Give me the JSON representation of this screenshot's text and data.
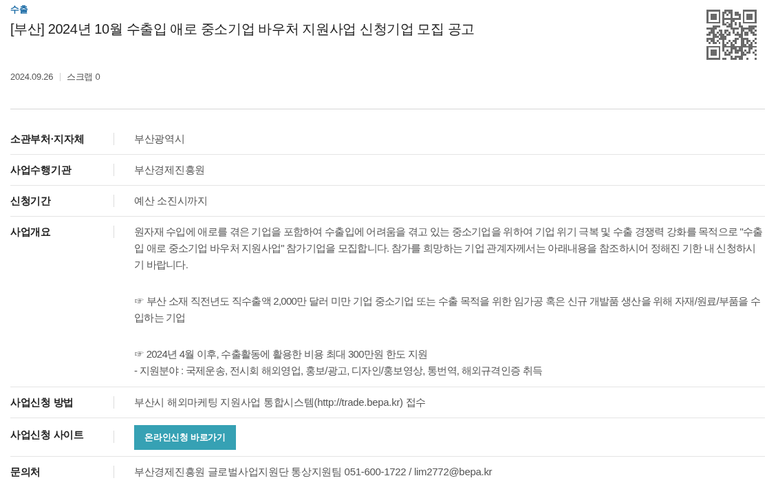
{
  "category": "수출",
  "title": "[부산] 2024년 10월 수출입 애로 중소기업 바우처 지원사업 신청기업 모집 공고",
  "meta": {
    "date": "2024.09.26",
    "scrap": "스크랩 0"
  },
  "details": [
    {
      "kind": "text",
      "label": "소관부처·지자체",
      "value": "부산광역시"
    },
    {
      "kind": "text",
      "label": "사업수행기관",
      "value": "부산경제진흥원"
    },
    {
      "kind": "text",
      "label": "신청기간",
      "value": "예산 소진시까지"
    },
    {
      "kind": "paragraphs",
      "label": "사업개요",
      "paragraphs": [
        [
          "원자재 수입에 애로를 겪은 기업을 포함하여 수출입에 어려움을 겪고 있는 중소기업을 위하여 기업 위기 극복 및 수출 경쟁력 강화를 목적으로 \"수출입 애로 중소기업 바우처 지원사업\" 참가기업을 모집합니다. 참가를 희망하는 기업 관계자께서는 아래내용을 참조하시어 정해진 기한 내 신청하시기 바랍니다."
        ],
        [
          "☞ 부산 소재 직전년도 직수출액 2,000만 달러 미만 기업 중소기업 또는 수출 목적을 위한 임가공 혹은 신규 개발품 생산을 위해 자재/원료/부품을 수입하는 기업"
        ],
        [
          "☞ 2024년 4월 이후, 수출활동에 활용한 비용 최대 300만원 한도 지원",
          "- 지원분야 : 국제운송, 전시회 해외영업, 홍보/광고, 디자인/홍보영상, 통번역, 해외규격인증 취득"
        ]
      ]
    },
    {
      "kind": "text",
      "label": "사업신청 방법",
      "value": "부산시 해외마케팅 지원사업 통합시스템(http://trade.bepa.kr) 접수"
    },
    {
      "kind": "button",
      "label": "사업신청 사이트",
      "button": "온라인신청 바로가기"
    },
    {
      "kind": "text",
      "label": "문의처",
      "value": "부산경제진흥원 글로벌사업지원단 통상지원팀 051-600-1722 / lim2772@bepa.kr"
    }
  ]
}
